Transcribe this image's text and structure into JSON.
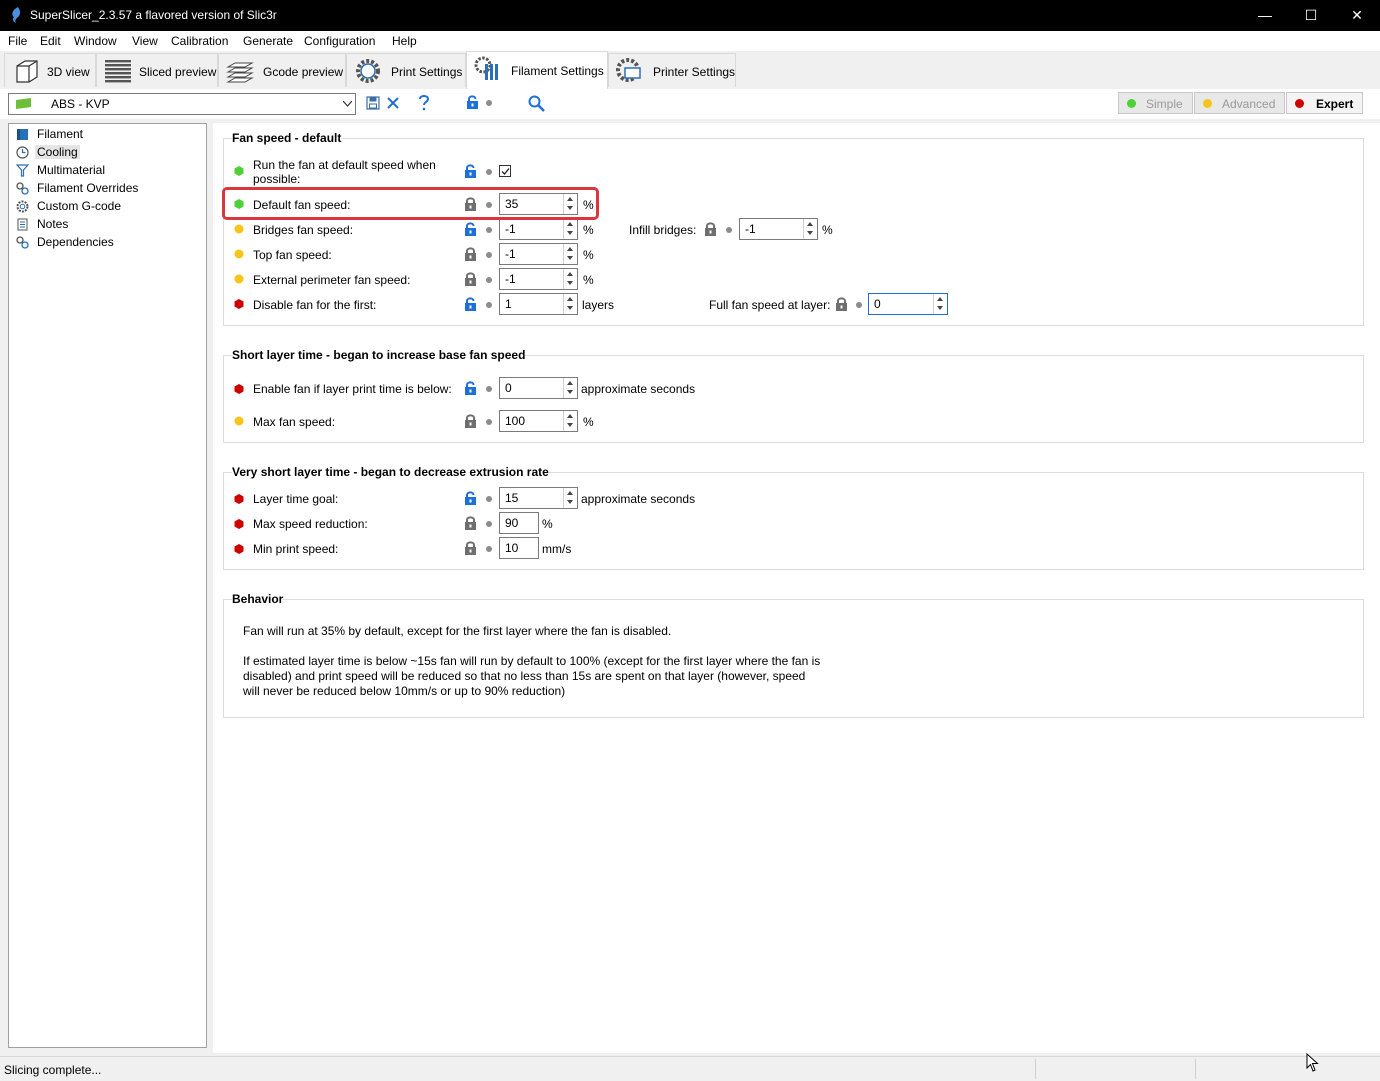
{
  "window": {
    "title": "SuperSlicer_2.3.57 a flavored version of Slic3r",
    "minimize": "—",
    "maximize": "☐",
    "close": "✕"
  },
  "menu": [
    "File",
    "Edit",
    "Window",
    "View",
    "Calibration",
    "Generate",
    "Configuration",
    "Help"
  ],
  "tabs": [
    {
      "label": "3D view",
      "icon": "cube-icon"
    },
    {
      "label": "Sliced preview",
      "icon": "layers-icon"
    },
    {
      "label": "Gcode preview",
      "icon": "gcode-layers-icon"
    },
    {
      "label": "Print Settings",
      "icon": "gear-icon"
    },
    {
      "label": "Filament Settings",
      "icon": "filament-spool-icon",
      "active": true
    },
    {
      "label": "Printer Settings",
      "icon": "printer-gear-icon"
    }
  ],
  "toolbar": {
    "preset": "ABS - KVP",
    "modes": {
      "simple": "Simple",
      "advanced": "Advanced",
      "expert": "Expert"
    }
  },
  "tree": [
    {
      "label": "Filament",
      "icon": "filament-icon"
    },
    {
      "label": "Cooling",
      "icon": "cooling-clock-icon",
      "selected": true
    },
    {
      "label": "Multimaterial",
      "icon": "funnel-icon"
    },
    {
      "label": "Filament Overrides",
      "icon": "wrench-gear-icon"
    },
    {
      "label": "Custom G-code",
      "icon": "gear-icon"
    },
    {
      "label": "Notes",
      "icon": "notes-icon"
    },
    {
      "label": "Dependencies",
      "icon": "wrench-gear-icon"
    }
  ],
  "groups": {
    "fan": {
      "title": "Fan speed - default",
      "run_fan_label": "Run the fan at default speed when possible:",
      "default_fan_label": "Default fan speed:",
      "default_fan_value": "35",
      "bridges_label": "Bridges fan speed:",
      "bridges_value": "-1",
      "infill_bridges_label": "Infill bridges:",
      "infill_bridges_value": "-1",
      "top_label": "Top fan speed:",
      "top_value": "-1",
      "ext_perim_label": "External perimeter fan speed:",
      "ext_perim_value": "-1",
      "disable_first_label": "Disable fan for the first:",
      "disable_first_value": "1",
      "layers_unit": "layers",
      "full_fan_label": "Full fan speed at layer:",
      "full_fan_value": "0",
      "pct": "%"
    },
    "short": {
      "title": "Short layer time - began to increase base fan speed",
      "enable_label": "Enable fan if layer print time is below:",
      "enable_value": "0",
      "seconds_unit": "approximate seconds",
      "max_fan_label": "Max fan speed:",
      "max_fan_value": "100",
      "pct": "%"
    },
    "very_short": {
      "title": "Very short layer time - began to decrease extrusion rate",
      "goal_label": "Layer time goal:",
      "goal_value": "15",
      "seconds_unit": "approximate seconds",
      "max_red_label": "Max speed reduction:",
      "max_red_value": "90",
      "pct": "%",
      "min_speed_label": "Min print speed:",
      "min_speed_value": "10",
      "mms": "mm/s"
    },
    "behavior": {
      "title": "Behavior",
      "line1": "Fan will run at 35% by default, except for the first layer where the fan is disabled.",
      "line2": "If estimated layer time is below ~15s fan will run by default to 100% (except for the first layer where the fan is disabled) and print speed will be reduced so that no less than 15s are spent on that layer (however, speed will never be reduced below 10mm/s or up to 90% reduction)"
    }
  },
  "status": "Slicing complete...",
  "colors": {
    "green": "#4cd137",
    "yellow": "#f5c518",
    "red": "#d00000",
    "lock_blue": "#1e6fd9",
    "lock_grey": "#6e6e6e",
    "highlight": "#d9363e"
  }
}
